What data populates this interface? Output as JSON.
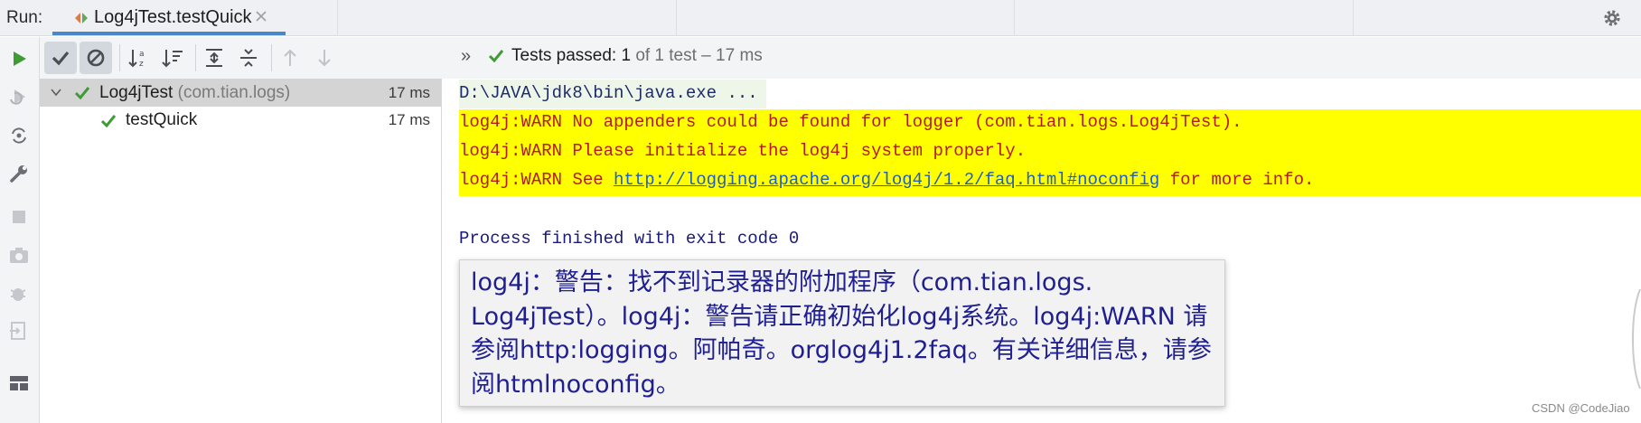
{
  "run_window": {
    "label": "Run:",
    "tab_title": "Log4jTest.testQuick",
    "icons": {
      "tab": "junit-run-icon",
      "close": "close-icon",
      "settings": "gear-icon"
    }
  },
  "left_toolbar": {
    "icons": [
      "rerun-icon",
      "rerun-failed-icon",
      "toggle-auto-test-icon",
      "settings-wrench-icon",
      "stop-icon",
      "screenshot-icon",
      "debug-icon",
      "exit-icon",
      "layout-icon"
    ]
  },
  "test_toolbar": {
    "icons": [
      "show-passed-icon",
      "show-ignored-icon",
      "sort-alphabetically-icon",
      "sort-by-duration-icon",
      "expand-all-icon",
      "collapse-all-icon",
      "previous-failed-icon",
      "next-failed-icon"
    ],
    "overflow": "»",
    "status_label": "Tests passed:",
    "status_count": "1",
    "status_rest": "of 1 test – 17 ms"
  },
  "tree": {
    "root": {
      "name": "Log4jTest",
      "package": "(com.tian.logs)",
      "time": "17 ms"
    },
    "children": [
      {
        "name": "testQuick",
        "time": "17 ms"
      }
    ]
  },
  "console": {
    "cmd": "D:\\JAVA\\jdk8\\bin\\java.exe ...",
    "warn1": "log4j:WARN No appenders could be found for logger (com.tian.logs.Log4jTest).",
    "warn2": "log4j:WARN Please initialize the log4j system properly.",
    "warn3_prefix": "log4j:WARN See ",
    "warn3_link": "http://logging.apache.org/log4j/1.2/faq.html#noconfig",
    "warn3_suffix": " for more info.",
    "exit": "Process finished with exit code 0"
  },
  "tooltip": {
    "text": "log4j：警告：找不到记录器的附加程序（com.tian.logs. Log4jTest）。log4j：警告请正确初始化log4j系统。log4j:WARN 请参阅http:logging。阿帕奇。orglog4j1.2faq。有关详细信息，请参阅htmlnoconfig。"
  },
  "watermark": "CSDN @CodeJiao",
  "colors": {
    "pass_green": "#3f9c35",
    "warn_bg": "#ffff00",
    "warn_text": "#b31b1b",
    "link": "#1f5fbf",
    "accent": "#4a86c8"
  }
}
